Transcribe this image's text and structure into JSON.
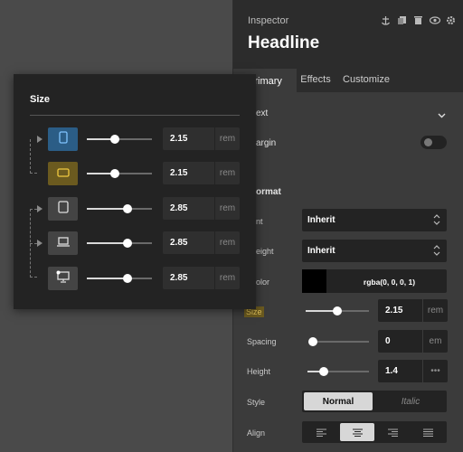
{
  "inspector": {
    "title": "Inspector",
    "headline": "Headline",
    "header_icons": [
      "anchor-icon",
      "copy-icon",
      "trash-icon",
      "eye-icon",
      "gear-icon"
    ]
  },
  "tabs": [
    {
      "label": "Primary",
      "active": true
    },
    {
      "label": "Effects",
      "active": false
    },
    {
      "label": "Customize",
      "active": false
    }
  ],
  "sections": {
    "text": "ext",
    "margin": "argin",
    "format": "ormat"
  },
  "fields": {
    "font_label": "nt",
    "font_value": "Inherit",
    "weight_label": "eight",
    "weight_value": "Inherit",
    "color_label": "olor",
    "color_value": "rgba(0, 0, 0, 1)",
    "size_label": "Size",
    "size_value": "2.15",
    "size_unit": "rem",
    "spacing_label": "Spacing",
    "spacing_value": "0",
    "spacing_unit": "em",
    "height_label": "Height",
    "height_value": "1.4",
    "height_unit": "•••",
    "style_label": "Style",
    "style_normal": "Normal",
    "style_italic": "Italic",
    "align_label": "Align"
  },
  "sliders": {
    "size": 0.5,
    "spacing": 0.05,
    "height": 0.27
  },
  "popup": {
    "title": "Size",
    "rows": [
      {
        "device": "phone-icon",
        "value": "2.15",
        "unit": "rem",
        "slider": 0.43
      },
      {
        "device": "landscape-icon",
        "value": "2.15",
        "unit": "rem",
        "slider": 0.43
      },
      {
        "device": "tablet-icon",
        "value": "2.85",
        "unit": "rem",
        "slider": 0.63
      },
      {
        "device": "laptop-icon",
        "value": "2.85",
        "unit": "rem",
        "slider": 0.63
      },
      {
        "device": "desktop-icon",
        "value": "2.85",
        "unit": "rem",
        "slider": 0.63
      }
    ]
  },
  "colors": {
    "accent_blue": "#2b5d86",
    "accent_yellow": "#6b5a1f",
    "size_highlight": "#6b5a1f"
  }
}
